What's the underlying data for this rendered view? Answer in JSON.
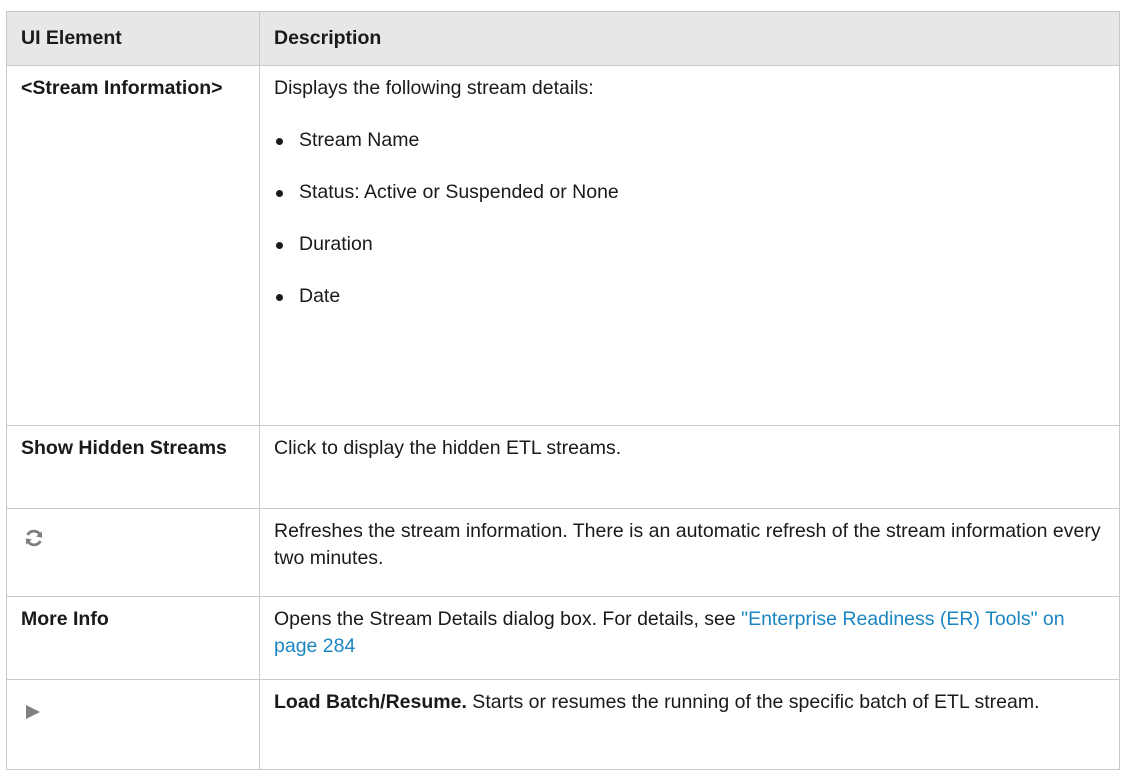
{
  "table": {
    "headers": [
      "UI Element",
      "Description"
    ],
    "rows": {
      "stream_info": {
        "element": "<Stream Information>",
        "description": "Displays the following stream details:",
        "bullets": [
          "Stream Name",
          "Status: Active or Suspended or None",
          "Duration",
          "Date"
        ]
      },
      "show_hidden": {
        "element": "Show Hidden Streams",
        "description": "Click to display the hidden ETL streams."
      },
      "refresh": {
        "icon": "refresh-icon",
        "description": "Refreshes the stream information. There is an automatic refresh of the stream information every two minutes."
      },
      "more_info": {
        "element": "More Info",
        "description_prefix": "Opens the Stream Details dialog box. For details, see ",
        "link_text": "\"Enterprise Readiness (ER) Tools\" on page 284"
      },
      "load_batch": {
        "icon": "play-icon",
        "bold_label": "Load Batch/Resume.",
        "description": " Starts or resumes the running of the specific batch of ETL stream."
      }
    }
  },
  "colors": {
    "header_bg": "#e7e7e7",
    "border": "#c9c9c9",
    "link": "#1b86c2",
    "icon_gray": "#7f7f7f"
  }
}
